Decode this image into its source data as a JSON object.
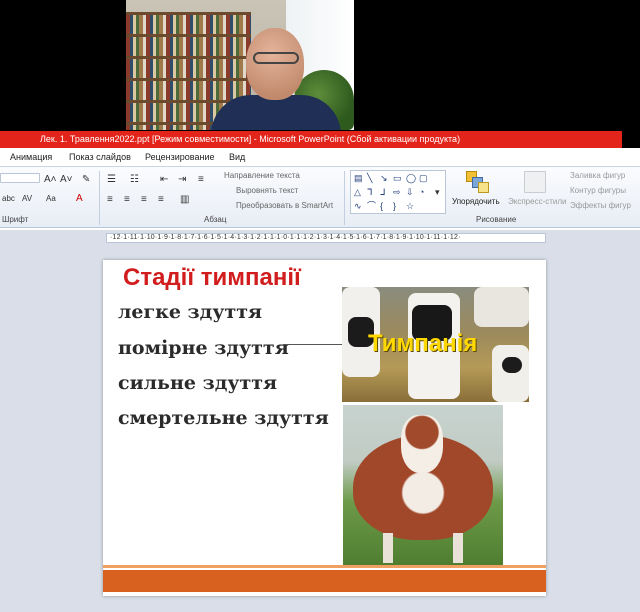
{
  "window": {
    "title": "Лек. 1. Травлення2022.ppt [Режим совместимости] - Microsoft PowerPoint (Сбой активации продукта)"
  },
  "ribbon": {
    "tabs": [
      "Анимация",
      "Показ слайдов",
      "Рецензирование",
      "Вид"
    ],
    "groups": {
      "font": "Шрифт",
      "paragraph": "Абзац",
      "drawing": "Рисование"
    },
    "paragraph": {
      "text_direction": "Направление текста",
      "align_text": "Выровнять текст",
      "convert_smartart": "Преобразовать в SmartArt"
    },
    "drawing": {
      "arrange": "Упорядочить",
      "quick_styles": "Экспресс-стили",
      "shape_fill": "Заливка фигур",
      "shape_outline": "Контур фигуры",
      "shape_effects": "Эффекты фигур"
    }
  },
  "ruler": {
    "text": "·12·1·11·1·10·1·9·1·8·1·7·1·6·1·5·1·4·1·3·1·2·1·1·1·0·1·1·1·2·1·3·1·4·1·5·1·6·1·7·1·8·1·9·1·10·1·11·1·12·"
  },
  "slide": {
    "title": "Стадії тимпанії",
    "stages": [
      "легке здуття",
      "помірне здуття",
      " сильне здуття",
      "смертельне здуття"
    ],
    "photo_label": "Тимпанія"
  },
  "colors": {
    "title_bar": "#e3241b",
    "slide_title": "#d11d1d",
    "photo_label": "#ffd800",
    "slide_footer": "#d8611f"
  }
}
